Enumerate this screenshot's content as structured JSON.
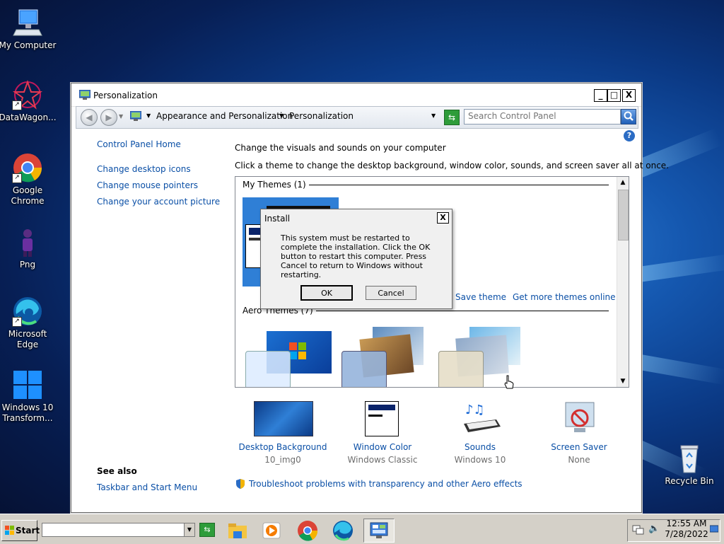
{
  "desktop": {
    "icons": [
      {
        "label": "My Computer"
      },
      {
        "label": "DataWagon..."
      },
      {
        "label": "Google Chrome"
      },
      {
        "label": "Png"
      },
      {
        "label": "Microsoft Edge"
      },
      {
        "label": "Windows 10 Transform..."
      },
      {
        "label": "Recycle Bin"
      }
    ]
  },
  "window": {
    "title": "Personalization",
    "buttons": {
      "minimize": "_",
      "maximize": "□",
      "close": "X"
    },
    "breadcrumb": {
      "level1": "Appearance and Personalization",
      "level2": "Personalization"
    },
    "search": {
      "placeholder": "Search Control Panel"
    },
    "help": "?",
    "left_nav": {
      "home": "Control Panel Home",
      "items": [
        "Change desktop icons",
        "Change mouse pointers",
        "Change your account picture"
      ],
      "see_also_title": "See also",
      "see_also_items": [
        "Taskbar and Start Menu"
      ]
    },
    "main": {
      "heading": "Change the visuals and sounds on your computer",
      "subheading": "Click a theme to change the desktop background, window color, sounds, and screen saver all at once.",
      "my_themes_title": "My Themes (1)",
      "save_theme": "Save theme",
      "get_more_themes": "Get more themes online",
      "aero_themes_title": "Aero Themes (7)"
    },
    "bottom": [
      {
        "title": "Desktop Background",
        "sub": "10_img0"
      },
      {
        "title": "Window Color",
        "sub": "Windows Classic"
      },
      {
        "title": "Sounds",
        "sub": "Windows 10"
      },
      {
        "title": "Screen Saver",
        "sub": "None"
      }
    ],
    "troubleshoot": "Troubleshoot problems with transparency and other Aero effects"
  },
  "dialog": {
    "title": "Install",
    "close": "X",
    "message": "This system must be restarted to complete the installation. Click the OK button to restart this computer. Press Cancel to return to Windows without restarting.",
    "ok": "OK",
    "cancel": "Cancel"
  },
  "taskbar": {
    "start": "Start",
    "time": "12:55 AM",
    "date": "7/28/2022"
  },
  "colors": {
    "link": "#0a4fa6",
    "sub_text": "#6d6d6d",
    "taskbar": "#d4d0c8"
  }
}
